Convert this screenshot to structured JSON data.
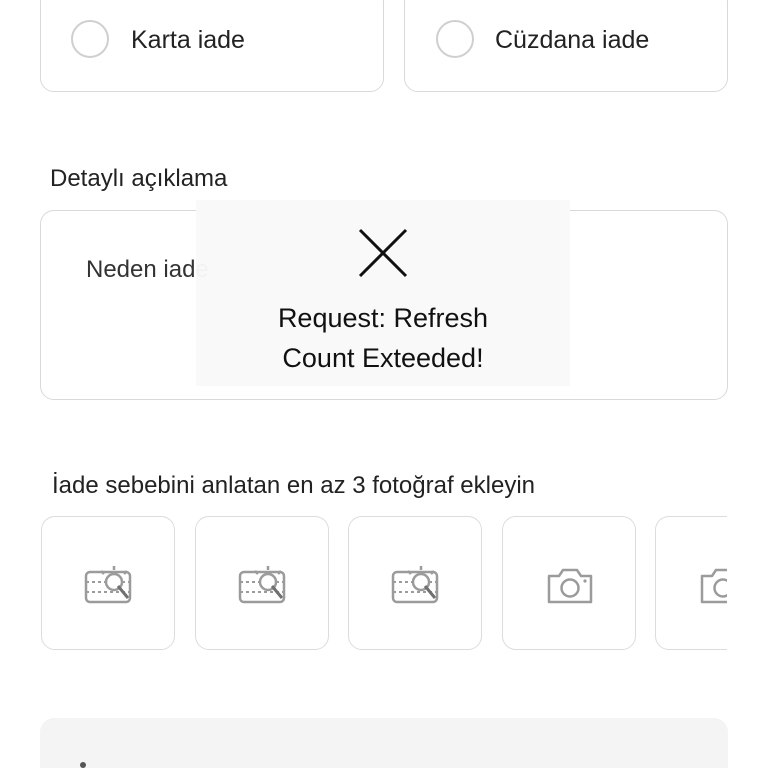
{
  "refund_options": [
    {
      "label": "Karta iade",
      "selected": false
    },
    {
      "label": "Cüzdana iade",
      "selected": false
    }
  ],
  "description": {
    "title": "Detaylı açıklama",
    "placeholder": "Neden iade"
  },
  "photos": {
    "title": "İade sebebini anlatan en az 3 fotoğraf ekleyin",
    "slots": [
      {
        "icon": "image-add-icon"
      },
      {
        "icon": "image-add-icon"
      },
      {
        "icon": "image-add-icon"
      },
      {
        "icon": "camera-icon"
      },
      {
        "icon": "camera-icon"
      }
    ]
  },
  "toast": {
    "icon": "close-icon",
    "message_line1": "Request: Refresh",
    "message_line2": "Count Exteeded!"
  },
  "colors": {
    "border": "#d9d9d9",
    "text": "#222222",
    "icon_gray": "#9b9b9b",
    "toast_bg": "#f9f9f9"
  }
}
